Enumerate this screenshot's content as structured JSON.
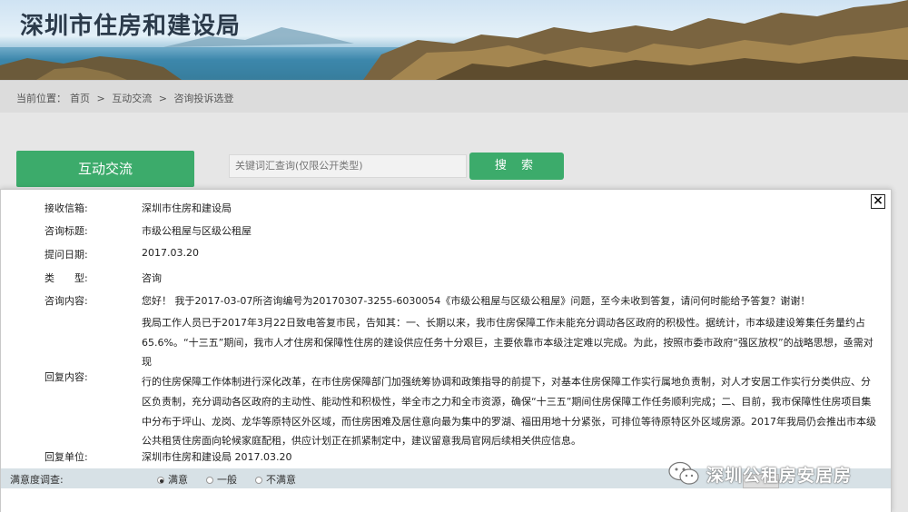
{
  "header": {
    "title": "深圳市住房和建设局"
  },
  "breadcrumb": {
    "prefix": "当前位置：",
    "items": [
      "首页",
      ">",
      "互动交流",
      ">",
      "咨询投诉选登"
    ]
  },
  "search": {
    "tab_label": "互动交流",
    "placeholder": "关键词汇查询(仅限公开类型)",
    "button_label": "搜 索"
  },
  "detail": {
    "fields": [
      {
        "label": "接收信箱:",
        "value": "深圳市住房和建设局"
      },
      {
        "label": "咨询标题:",
        "value": "市级公租屋与区级公租屋"
      },
      {
        "label": "提问日期:",
        "value": "2017.03.20"
      },
      {
        "label": "类　　型:",
        "value": "咨询"
      },
      {
        "label": "咨询内容:",
        "value": "您好！ 我于2017-03-07所咨询编号为20170307-3255-6030054《市级公租屋与区级公租屋》问题，至今未收到答复，请问何时能给予答复？谢谢！"
      }
    ],
    "reply_label": "回复内容:",
    "reply_lines": [
      "我局工作人员已于2017年3月22日致电答复市民，告知其：一、长期以来，我市住房保障工作未能充分调动各区政府的积极性。据统计，市本级建设筹集任务量约占",
      "65.6%。“十三五”期间，我市人才住房和保障性住房的建设供应任务十分艰巨，主要依靠市本级注定难以完成。为此，按照市委市政府“强区放权”的战略思想，亟需对现",
      "行的住房保障工作体制进行深化改革，在市住房保障部门加强统筹协调和政策指导的前提下，对基本住房保障工作实行属地负责制，对人才安居工作实行分类供应、分",
      "区负责制，充分调动各区政府的主动性、能动性和积极性，举全市之力和全市资源，确保“十三五”期间住房保障工作任务顺利完成；二、目前，我市保障性住房项目集",
      "中分布于坪山、龙岗、龙华等原特区外区域，而住房困难及居住意向最为集中的罗湖、福田用地十分紧张，可排位等待原特区外区域房源。2017年我局仍会推出市本级",
      "公共租赁住房面向轮候家庭配租，供应计划正在抓紧制定中，建议留意我局官网后续相关供应信息。"
    ],
    "reply_unit_label": "回复单位:",
    "reply_unit_value": "深圳市住房和建设局 2017.03.20",
    "close_label": "×"
  },
  "satisfaction": {
    "label": "满意度调查:",
    "options": [
      {
        "label": "满意",
        "selected": true
      },
      {
        "label": "一般",
        "selected": false
      },
      {
        "label": "不满意",
        "selected": false
      }
    ]
  },
  "watermark": {
    "text": "深圳公租房安居房"
  },
  "colors": {
    "accent_green": "#3cab6b",
    "satisfaction_bar": "#d7e1e6"
  }
}
